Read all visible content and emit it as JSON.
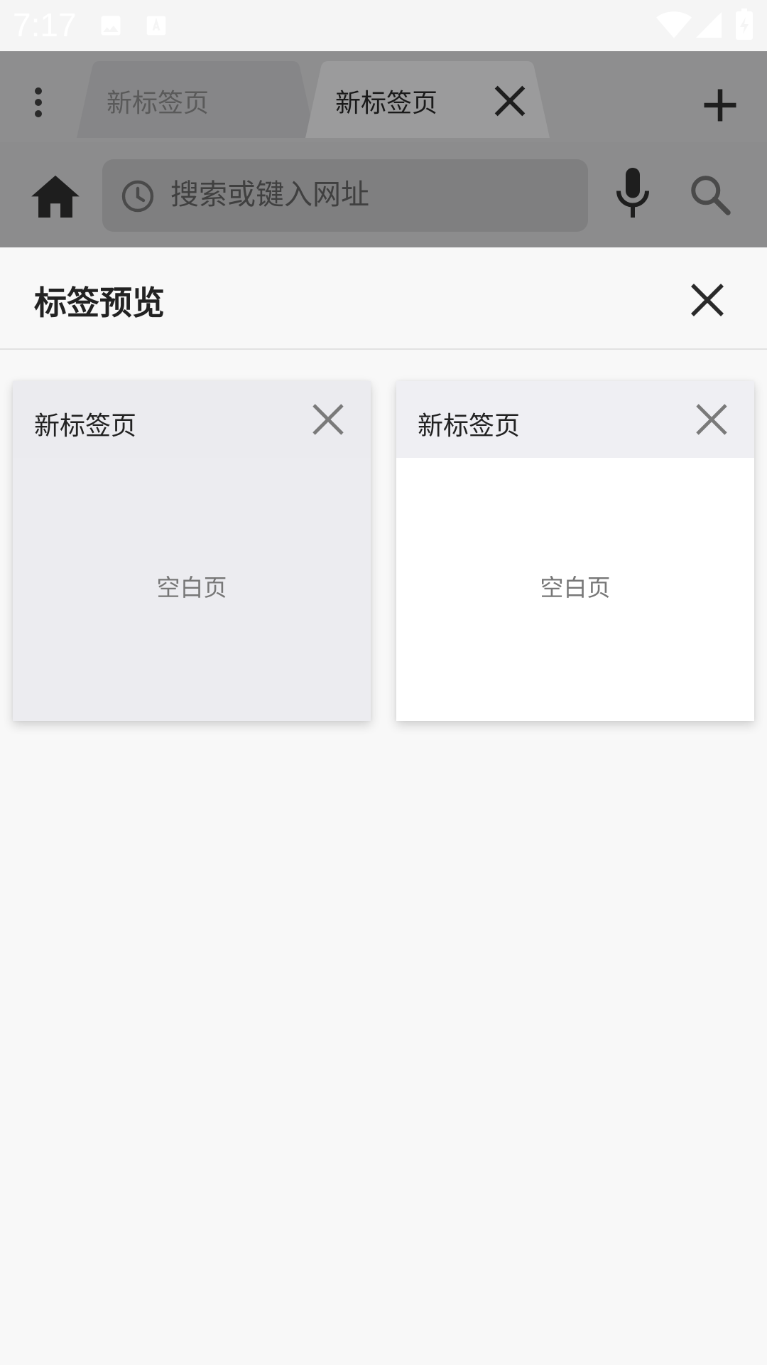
{
  "status_bar": {
    "time": "7:17",
    "icons": [
      "image-icon",
      "font-a-icon",
      "wifi-icon",
      "signal-icon",
      "battery-charging-icon"
    ]
  },
  "tabs": {
    "menu_icon": "more-vert-icon",
    "items": [
      {
        "label": "新标签页",
        "active": false
      },
      {
        "label": "新标签页",
        "active": true,
        "close_icon": "close-icon"
      }
    ],
    "new_tab_icon": "plus-icon"
  },
  "toolbar": {
    "home_icon": "home-icon",
    "history_icon": "history-clock-icon",
    "url_placeholder": "搜索或键入网址",
    "url_value": "",
    "mic_icon": "mic-icon",
    "search_icon": "search-icon"
  },
  "preview": {
    "title": "标签预览",
    "close_icon": "close-icon",
    "cards": [
      {
        "title": "新标签页",
        "body": "空白页"
      },
      {
        "title": "新标签页",
        "body": "空白页"
      }
    ]
  },
  "colors": {
    "chrome_dimmed": "#8e8e8f",
    "panel_bg": "#f8f8f8",
    "card_selected_bg": "#ececf0",
    "card_bg": "#ffffff"
  }
}
